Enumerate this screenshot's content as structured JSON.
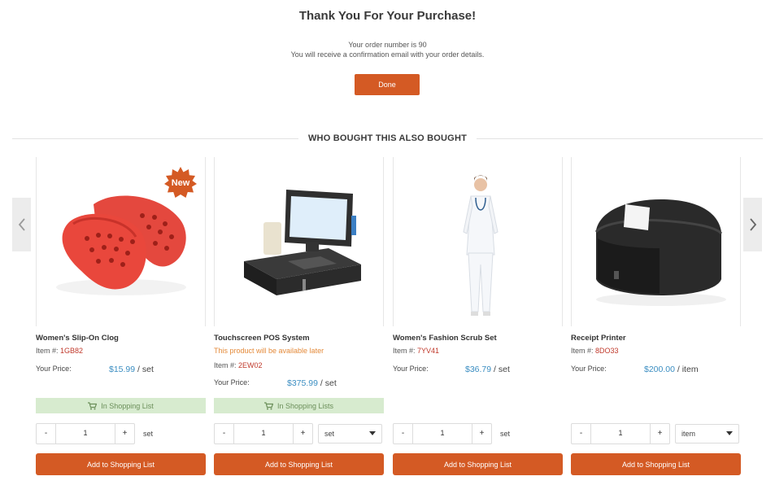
{
  "header": {
    "title": "Thank You For Your Purchase!",
    "order_line": "Your order number is 90",
    "email_line": "You will receive a confirmation email with your order details.",
    "done_label": "Done"
  },
  "section": {
    "title": "WHO BOUGHT THIS ALSO BOUGHT"
  },
  "colors": {
    "accent": "#d45a24",
    "price": "#3b8ec2",
    "item_code": "#c0392b",
    "in_list_bg": "#d7ebcf"
  },
  "products": [
    {
      "name": "Women's Slip-On Clog",
      "item_label": "Item #:",
      "item_code": "1GB82",
      "badge": "New",
      "price_label": "Your Price:",
      "price": "$15.99",
      "price_unit": "/ set",
      "in_list_label": "In Shopping List",
      "qty_minus": "-",
      "qty_plus": "+",
      "qty": "1",
      "unit": "set",
      "add_label": "Add to Shopping List"
    },
    {
      "name": "Touchscreen POS System",
      "availability": "This product will be available later",
      "item_label": "Item #:",
      "item_code": "2EW02",
      "price_label": "Your Price:",
      "price": "$375.99",
      "price_unit": "/ set",
      "in_list_label": "In Shopping Lists",
      "qty_minus": "-",
      "qty_plus": "+",
      "qty": "1",
      "unit": "set",
      "add_label": "Add to Shopping List"
    },
    {
      "name": "Women's Fashion Scrub Set",
      "item_label": "Item #:",
      "item_code": "7YV41",
      "price_label": "Your Price:",
      "price": "$36.79",
      "price_unit": "/ set",
      "qty_minus": "-",
      "qty_plus": "+",
      "qty": "1",
      "unit": "set",
      "add_label": "Add to Shopping List"
    },
    {
      "name": "Receipt Printer",
      "item_label": "Item #:",
      "item_code": "8DO33",
      "price_label": "Your Price:",
      "price": "$200.00",
      "price_unit": "/ item",
      "qty_minus": "-",
      "qty_plus": "+",
      "qty": "1",
      "unit": "item",
      "add_label": "Add to Shopping List"
    }
  ],
  "icons": {
    "prev": "chevron-left-icon",
    "next": "chevron-right-icon",
    "cart": "cart-icon"
  }
}
